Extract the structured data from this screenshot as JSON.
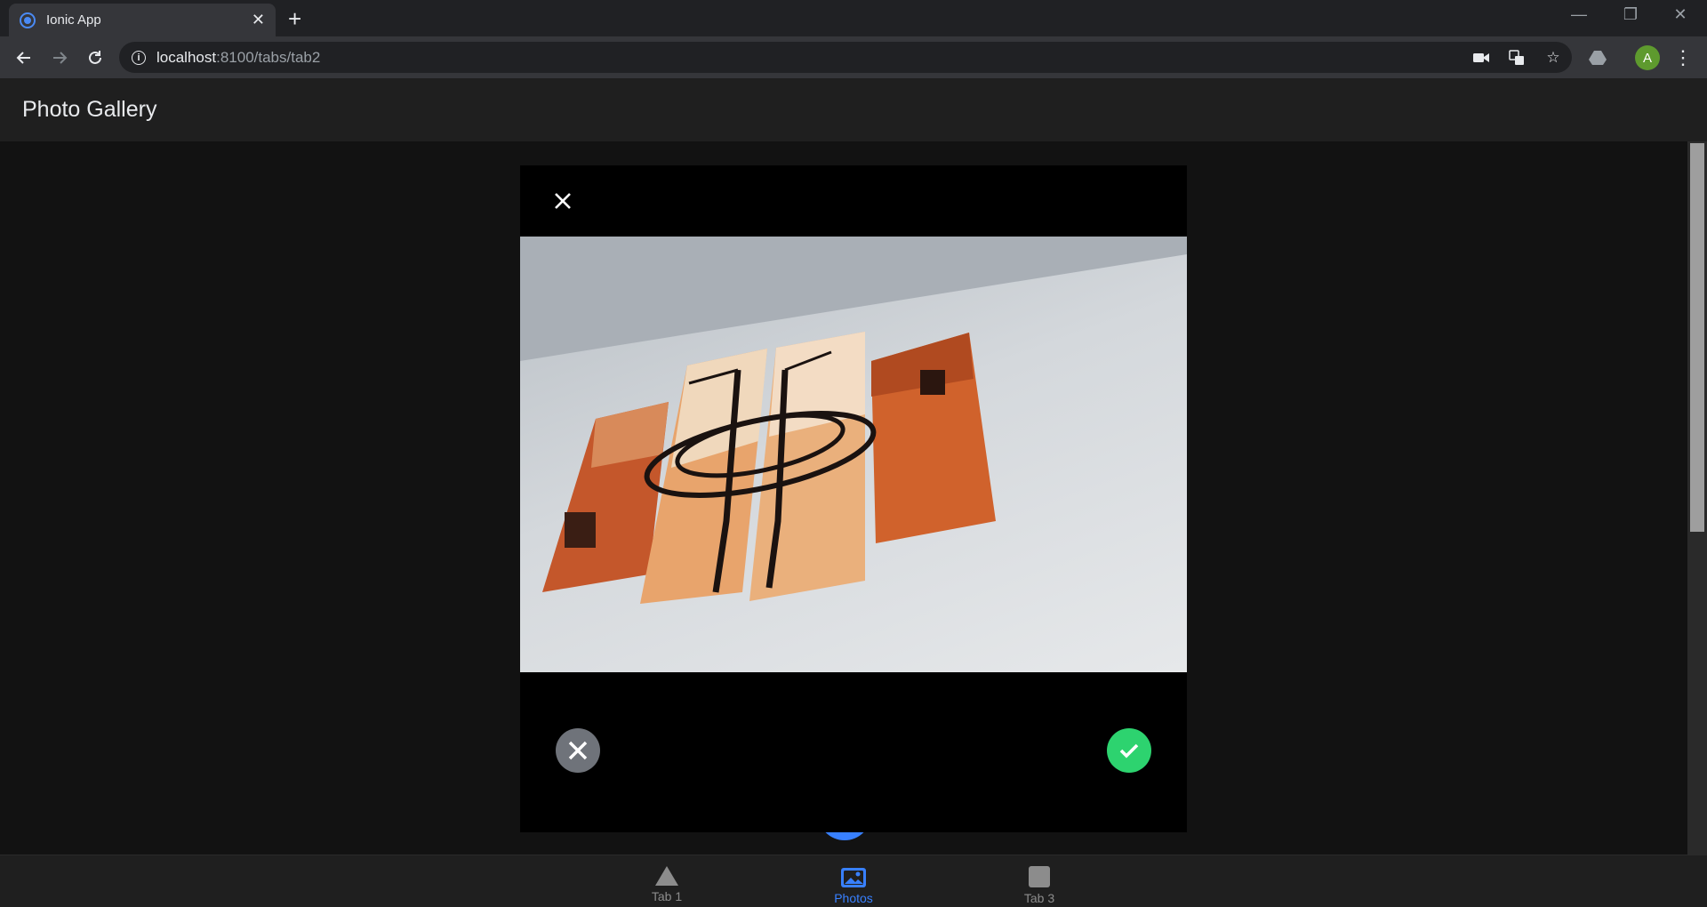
{
  "browser": {
    "tab_title": "Ionic App",
    "url_host": "localhost",
    "url_path": ":8100/tabs/tab2",
    "profile_initial": "A"
  },
  "app": {
    "title": "Photo Gallery"
  },
  "tabs": [
    {
      "label": "Tab 1",
      "icon": "triangle-icon",
      "active": false
    },
    {
      "label": "Photos",
      "icon": "images-icon",
      "active": true
    },
    {
      "label": "Tab 3",
      "icon": "square-icon",
      "active": false
    }
  ],
  "colors": {
    "accent": "#3880ff",
    "accept": "#2dd36f",
    "reject": "#6f737a"
  }
}
